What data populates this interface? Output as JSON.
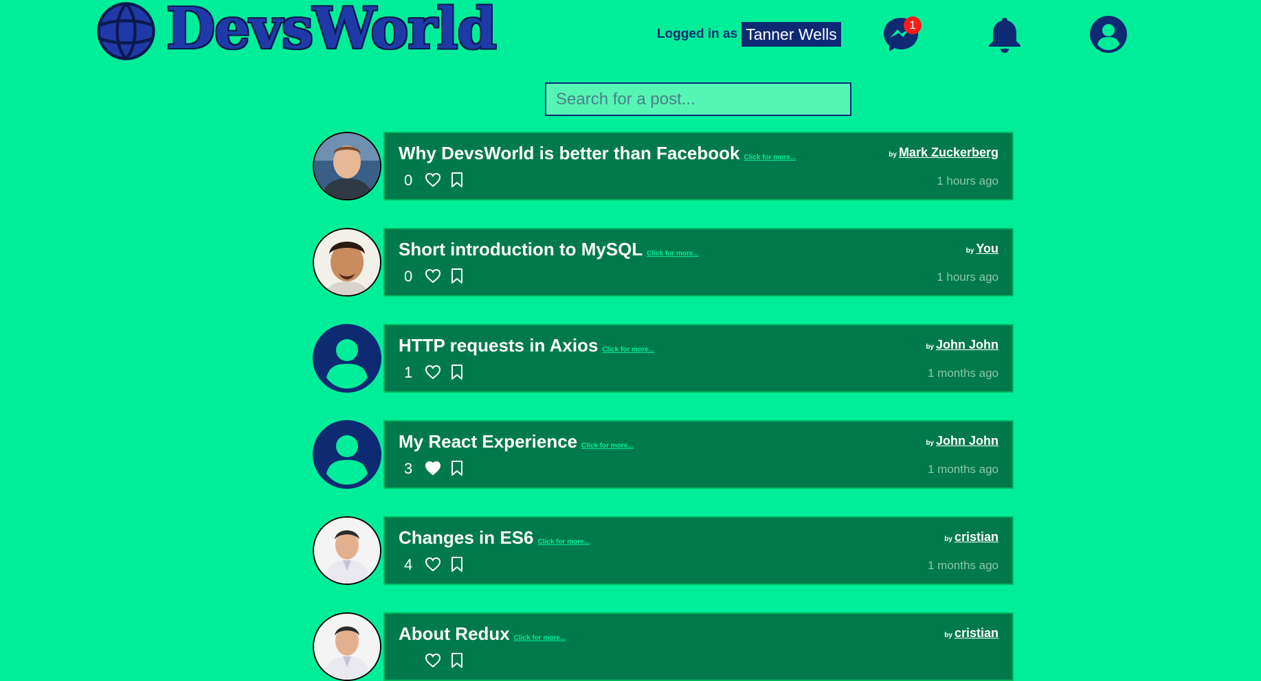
{
  "app": {
    "name": "DevsWorld"
  },
  "header": {
    "logged_in_label": "Logged in as",
    "username": "Tanner Wells",
    "messenger_badge": "1"
  },
  "search": {
    "placeholder": "Search for a post..."
  },
  "posts": [
    {
      "title": "Why DevsWorld is better than Facebook",
      "more": "Click for more...",
      "by": "by",
      "author": "Mark Zuckerberg",
      "likes": "0",
      "liked": false,
      "time": "1 hours ago",
      "avatar": "photo-mark"
    },
    {
      "title": "Short introduction to MySQL",
      "more": "Click for more...",
      "by": "by",
      "author": "You",
      "likes": "0",
      "liked": false,
      "time": "1 hours ago",
      "avatar": "photo-you"
    },
    {
      "title": "HTTP requests in Axios",
      "more": "Click for more...",
      "by": "by",
      "author": "John John",
      "likes": "1",
      "liked": false,
      "time": "1 months ago",
      "avatar": "default"
    },
    {
      "title": "My React Experience",
      "more": "Click for more...",
      "by": "by",
      "author": "John John",
      "likes": "3",
      "liked": true,
      "time": "1 months ago",
      "avatar": "default"
    },
    {
      "title": "Changes in ES6",
      "more": "Click for more...",
      "by": "by",
      "author": "cristian",
      "likes": "4",
      "liked": false,
      "time": "1 months ago",
      "avatar": "photo-cristian"
    },
    {
      "title": "About Redux",
      "more": "Click for more...",
      "by": "by",
      "author": "cristian",
      "likes": "",
      "liked": false,
      "time": "",
      "avatar": "photo-cristian"
    }
  ],
  "colors": {
    "background": "#00ee99",
    "navy": "#0d2a73",
    "card": "#007a4d",
    "card_border": "#00b75d",
    "badge": "#ff1a1a"
  }
}
